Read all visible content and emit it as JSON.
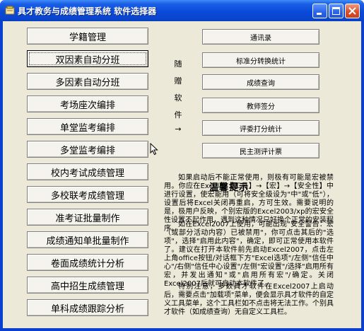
{
  "window": {
    "title": "具才教务与成绩管理系统  软件选择器"
  },
  "left_buttons": [
    {
      "label": "学籍管理"
    },
    {
      "label": "双因素自动分班"
    },
    {
      "label": "多因素自动分班"
    },
    {
      "label": "考场座次编排"
    },
    {
      "label": "单堂监考编排"
    },
    {
      "label": "多堂监考编排"
    },
    {
      "label": "校内考试成绩管理"
    },
    {
      "label": "多校联考成绩管理"
    },
    {
      "label": "准考证批量制作"
    },
    {
      "label": "成绩通知单批量制作"
    },
    {
      "label": "卷面成绩统计分析"
    },
    {
      "label": "高中招生成绩管理"
    },
    {
      "label": "单科成绩跟踪分析"
    }
  ],
  "right_buttons": [
    {
      "label": "通讯录"
    },
    {
      "label": "标准分转换统计"
    },
    {
      "label": "成绩查询"
    },
    {
      "label": "教师签分"
    },
    {
      "label": "评委打分统计"
    },
    {
      "label": "民主测评计票"
    }
  ],
  "gift_label": [
    "随",
    "赠",
    "软",
    "件",
    "→"
  ],
  "tips": {
    "title": "温馨提示",
    "paragraphs": [
      "如果启动后不能正常使用，则极有可能是宏被禁用。你应在Excel的【工具】→【宏】→【安全性】中进行设置，使宏能用（可将安全级设为\"中\"或\"低\"），设置后将Excel关闭再重启，方可生效。需要说明的是，极用户反映，个别宏版的Excel2003/xp的宏安全性设置不起作用，遇到这种情况只好换个正常的安装程序。",
      "如在Excel2007上使用，可能出现\"安全警告：宏（或部分活动内容）已被禁用\"，你可点击其后的\"选项\"，选择\"启用此内容\"，确定，即可正常使用本软件了。建议在打开本软件前先启动Excel2007，点击左上角office按钮/对话框下方\"Excel选项\"/左侧\"信任中心\"/右侧\"信任中心设置\"/左侧\"宏设置\"/选择\"启用所有宏，并发出通知\"或\"启用所有宏\"/确定。关闭Excel2007后就可启动本软件了。",
      "特别注意，多数具才软件在Excel2007上启动后，需要点击\"加载项\"菜单，便会显示具才软件的自定义工具菜单，这个工具栏如不点击将无法工作。个别具才软件（如成绩查询）无自定义工具栏。"
    ]
  },
  "colors": {
    "title_bar": "#0a46cf",
    "client_bg": "#ece9d8",
    "close_button": "#d9512c"
  }
}
